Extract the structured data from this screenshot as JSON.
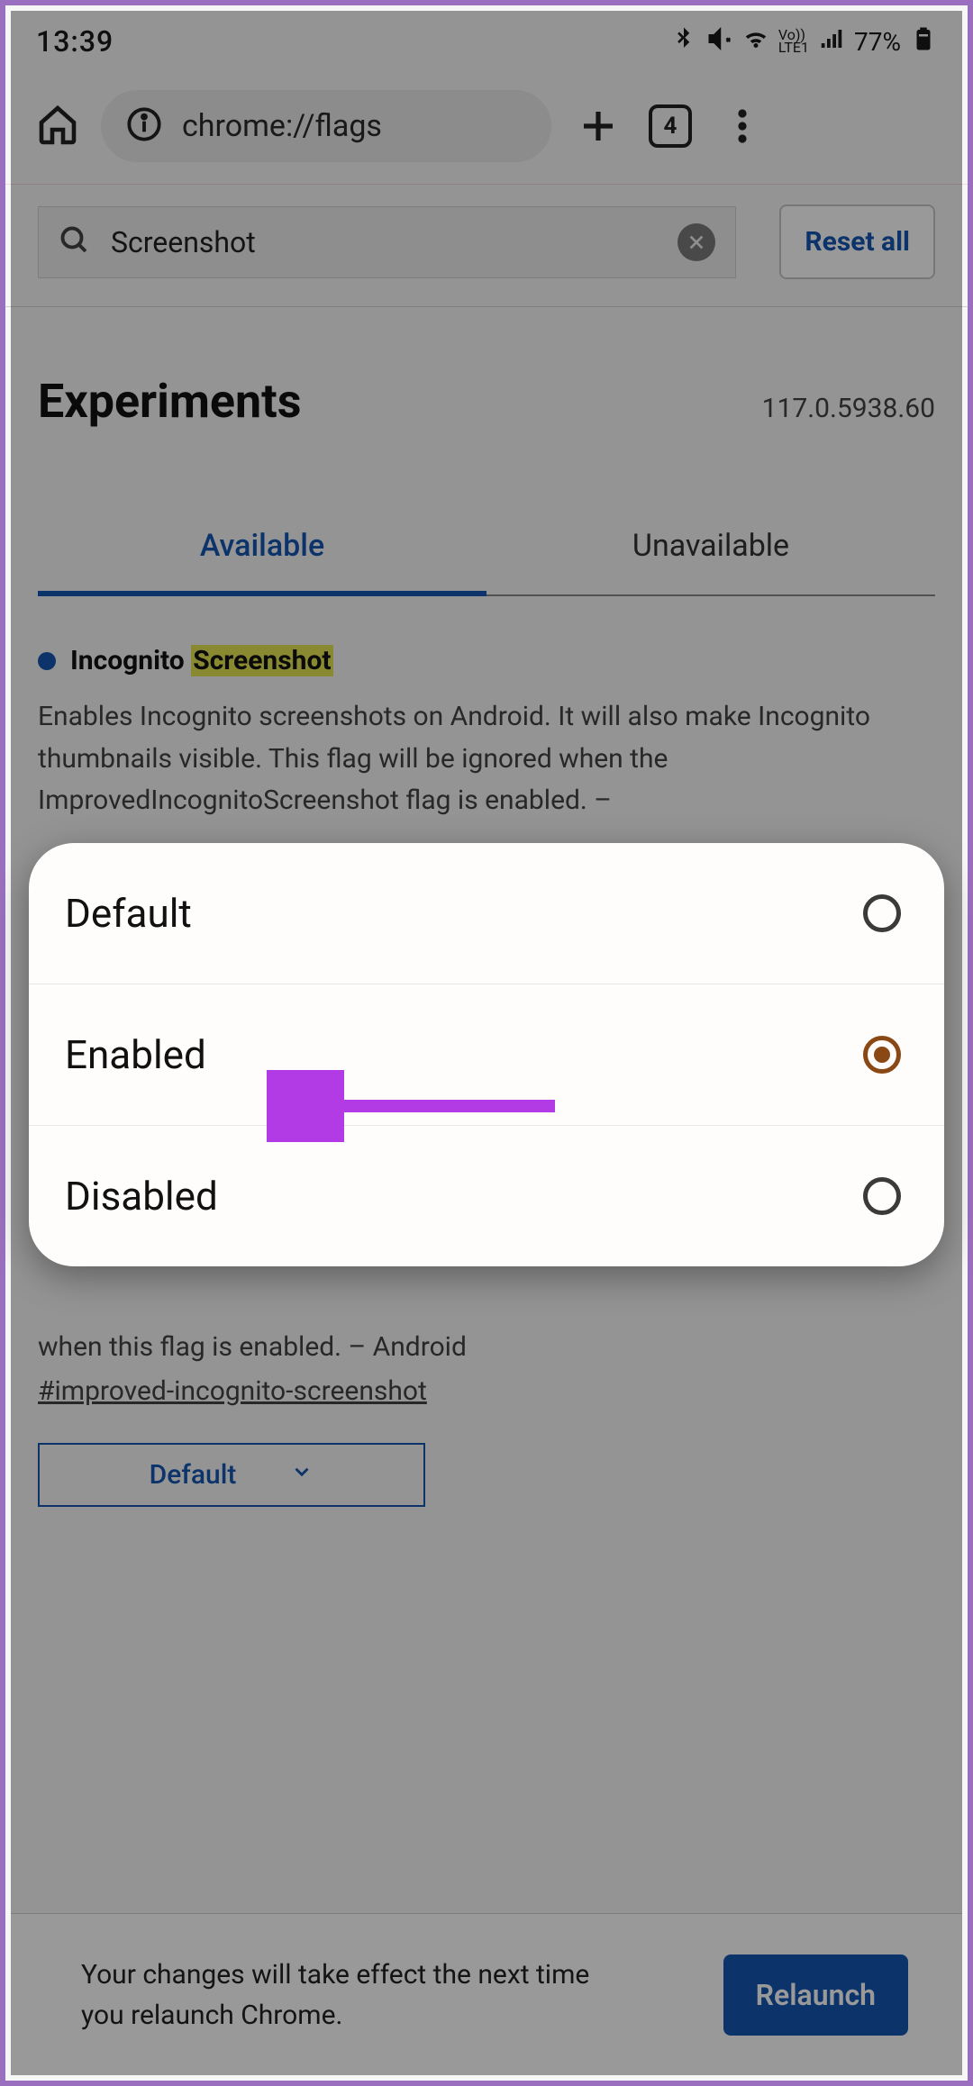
{
  "status": {
    "time": "13:39",
    "battery_text": "77%"
  },
  "toolbar": {
    "url": "chrome://flags",
    "tabs_count": "4"
  },
  "search": {
    "query": "Screenshot",
    "reset_label": "Reset all"
  },
  "heading": "Experiments",
  "version": "117.0.5938.60",
  "tabs": {
    "available": "Available",
    "unavailable": "Unavailable"
  },
  "flag1": {
    "title_prefix": "Incognito ",
    "title_hl": "Screenshot",
    "desc": "Enables Incognito screenshots on Android. It will also make Incognito thumbnails visible. This flag will be ignored when the ImprovedIncognitoScreenshot flag is enabled. –"
  },
  "flag2": {
    "desc_tail": "when this flag is enabled. – Android",
    "hash": "#improved-incognito-screenshot",
    "select_value": "Default"
  },
  "bottom": {
    "msg": "Your changes will take effect the next time you relaunch Chrome.",
    "relaunch": "Relaunch"
  },
  "popup": {
    "opt_default": "Default",
    "opt_enabled": "Enabled",
    "opt_disabled": "Disabled"
  }
}
